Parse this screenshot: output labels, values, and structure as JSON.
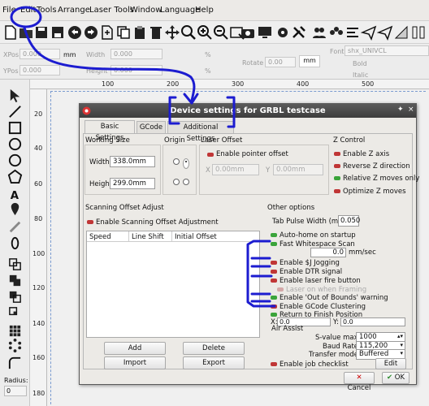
{
  "menu": [
    "File",
    "Edit",
    "Tools",
    "Arrange",
    "Laser Tools",
    "Window",
    "Language",
    "Help"
  ],
  "props": {
    "xpos_label": "XPos",
    "xpos_value": "0.000",
    "ypos_label": "YPos",
    "ypos_value": "0.000",
    "width_label": "Width",
    "width_value": "0.000",
    "height_label": "Height",
    "height_value": "0.000",
    "percent": "%",
    "rotate_label": "Rotate",
    "rotate_value": "0.00",
    "unit": "mm",
    "font_label": "Font",
    "font_value": "shx_UNIVCL",
    "bold": "Bold",
    "italic": "Italic"
  },
  "ruler_top": [
    "100",
    "200",
    "300",
    "400",
    "500"
  ],
  "ruler_left": [
    "20",
    "40",
    "60",
    "80",
    "100",
    "120",
    "140",
    "160",
    "180"
  ],
  "radius_label": "Radius:",
  "radius_value": "0",
  "dialog": {
    "title": "Device settings for GRBL testcase",
    "tabs": [
      "Basic Settings",
      "GCode",
      "Additional Settings"
    ],
    "working_size": {
      "header": "Working Size",
      "width_label": "Width",
      "width_value": "338.0mm",
      "height_label": "Height",
      "height_value": "299.0mm"
    },
    "origin": {
      "header": "Origin"
    },
    "laser_offset": {
      "header": "Laser Offset",
      "enable": "Enable pointer offset",
      "x_label": "X",
      "x_value": "0.00mm",
      "y_label": "Y",
      "y_value": "0.00mm"
    },
    "z_control": {
      "header": "Z Control",
      "items": [
        "Enable Z axis",
        "Reverse Z direction",
        "Relative Z moves only",
        "Optimize Z moves"
      ]
    },
    "scan": {
      "header": "Scanning Offset Adjust",
      "enable": "Enable Scanning Offset Adjustment",
      "columns": [
        "Speed",
        "Line Shift",
        "Initial Offset"
      ],
      "buttons": [
        "Add",
        "Delete",
        "Import",
        "Export"
      ]
    },
    "other": {
      "header": "Other options",
      "tab_pulse_label": "Tab Pulse Width (mm)",
      "tab_pulse_value": "0.050",
      "items": [
        "Auto-home on startup",
        "Fast Whitespace Scan",
        "Enable $J Jogging",
        "Enable DTR signal",
        "Enable laser fire button",
        "Laser on when Framing",
        "Enable 'Out of Bounds' warning",
        "Enable GCode Clustering",
        "Return to Finish Position"
      ],
      "scan_value": "0.0",
      "scan_unit": "mm/sec",
      "x_label": "X:",
      "x_value": "0.0",
      "y_label": "Y:",
      "y_value": "0.0"
    },
    "air": {
      "header": "Air Assist",
      "svalue_label": "S-value max",
      "svalue": "1000",
      "baud_label": "Baud Rate",
      "baud": "115,200",
      "transfer_label": "Transfer mode",
      "transfer": "Buffered",
      "checklist": "Enable job checklist",
      "edit": "Edit"
    },
    "cancel": "Cancel",
    "ok": "OK"
  },
  "colors": {
    "annotation": "#1c1cd0",
    "toggle_on": "#3aa43a",
    "toggle_off": "#c03636",
    "title_bar": "#4a4a4a"
  }
}
